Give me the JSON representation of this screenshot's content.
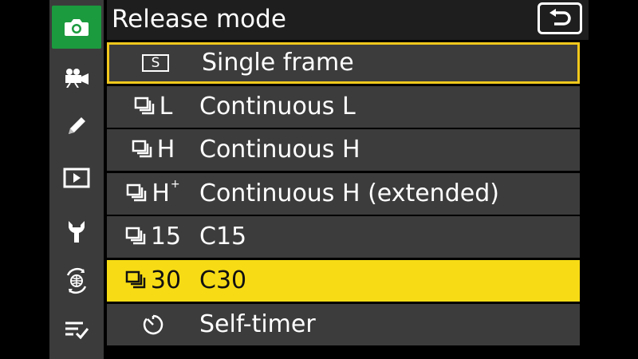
{
  "header": {
    "title": "Release mode",
    "back_icon": "return-arrow-icon"
  },
  "sidebar": {
    "items": [
      {
        "icon": "camera-icon",
        "active": true
      },
      {
        "icon": "movie-camera-icon",
        "active": false
      },
      {
        "icon": "pencil-icon",
        "active": false
      },
      {
        "icon": "playback-icon",
        "active": false
      },
      {
        "icon": "wrench-icon",
        "active": false
      },
      {
        "icon": "network-icon",
        "active": false
      },
      {
        "icon": "my-menu-icon",
        "active": false
      }
    ]
  },
  "menu": {
    "items": [
      {
        "icon_text": "S",
        "label": "Single frame",
        "focused": true,
        "selected": false
      },
      {
        "icon_text": "L",
        "label": "Continuous L",
        "focused": false,
        "selected": false
      },
      {
        "icon_text": "H",
        "label": "Continuous H",
        "focused": false,
        "selected": false
      },
      {
        "icon_text": "H",
        "icon_sup": "+",
        "label": "Continuous H (extended)",
        "focused": false,
        "selected": false
      },
      {
        "icon_text": "15",
        "label": "C15",
        "focused": false,
        "selected": false
      },
      {
        "icon_text": "30",
        "label": "C30",
        "focused": false,
        "selected": true
      },
      {
        "icon_text": "",
        "label": "Self-timer",
        "focused": false,
        "selected": false
      }
    ]
  },
  "colors": {
    "active_tab": "#1b9a3e",
    "highlight": "#f7dc15",
    "focus_border": "#f2c81c",
    "row_bg": "#3c3c3c",
    "sidebar_bg": "#3b3b3b"
  }
}
